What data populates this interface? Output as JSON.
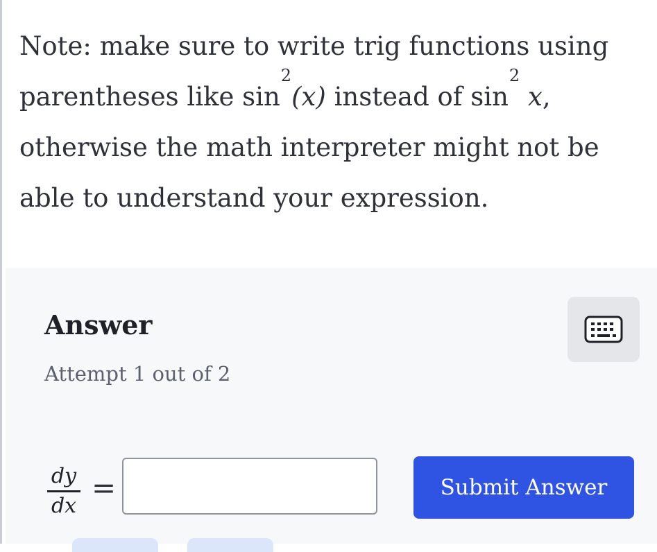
{
  "note": {
    "part1": "Note: make sure to write trig functions using parentheses like",
    "ex1_fn": "sin",
    "ex1_exp": "2",
    "ex1_arg": "(x)",
    "part2": "instead of",
    "ex2_fn": "sin",
    "ex2_exp": "2",
    "ex2_var": "x",
    "part3": ", otherwise the math interpreter might not be able to understand your expression."
  },
  "answer": {
    "title": "Answer",
    "attempt": "Attempt 1 out of 2",
    "lhs_numerator": "dy",
    "lhs_denominator": "dx",
    "equals": "=",
    "input_value": "",
    "submit_label": "Submit Answer"
  },
  "icons": {
    "keyboard": "keyboard-icon"
  },
  "colors": {
    "submit_bg": "#2f54e3",
    "panel_bg": "#f7f8fa",
    "keyboard_btn_bg": "#e4e6ea"
  }
}
